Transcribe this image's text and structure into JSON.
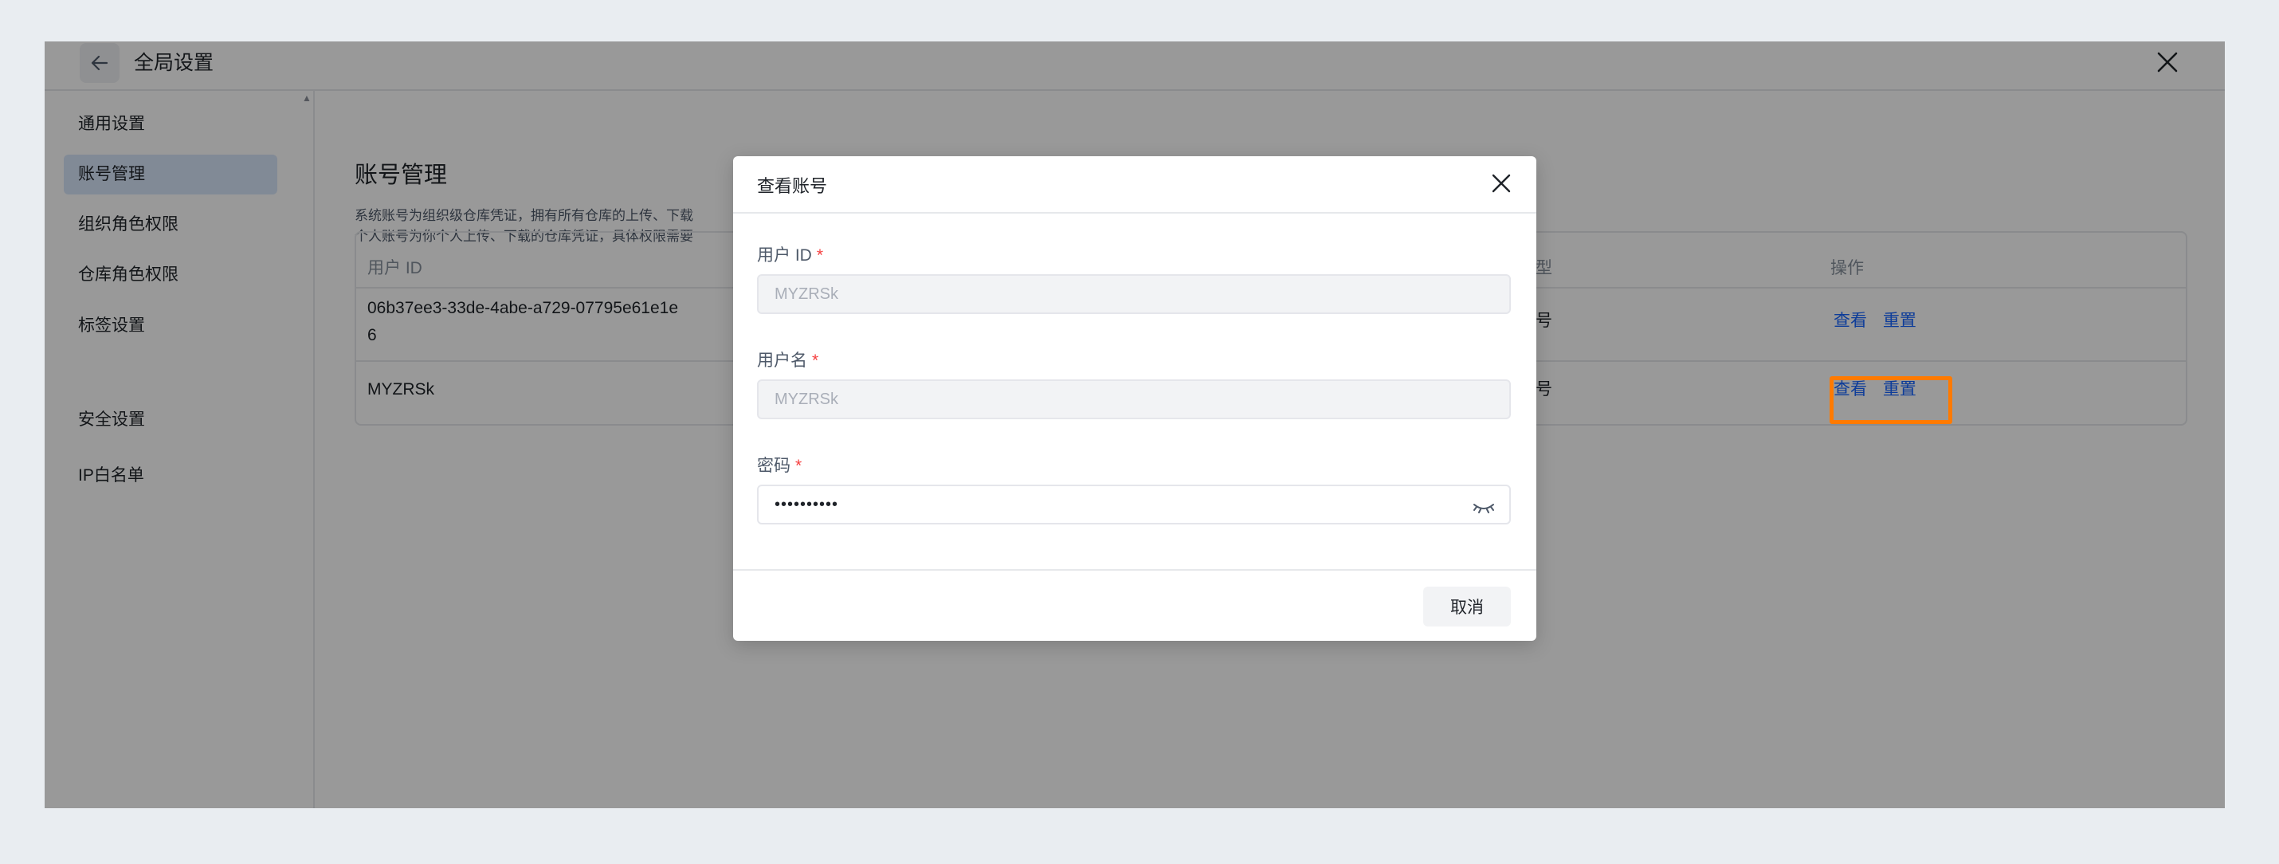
{
  "header": {
    "title": "全局设置"
  },
  "sidebar": {
    "items": [
      {
        "label": "通用设置",
        "active": false
      },
      {
        "label": "账号管理",
        "active": true
      },
      {
        "label": "组织角色权限",
        "active": false
      },
      {
        "label": "仓库角色权限",
        "active": false
      },
      {
        "label": "标签设置",
        "active": false
      },
      {
        "label": "安全设置",
        "active": false
      },
      {
        "label": "IP白名单",
        "active": false
      }
    ]
  },
  "main": {
    "title": "账号管理",
    "desc_line1": "系统账号为组织级仓库凭证，拥有所有仓库的上传、下载",
    "desc_line2": "个人账号为你个人上传、下载的仓库凭证，具体权限需要",
    "table": {
      "headers": {
        "user_id": "用户 ID",
        "type": "型",
        "actions": "操作"
      },
      "rows": [
        {
          "user_id_line1": "06b37ee3-33de-4abe-a729-07795e61e1e",
          "user_id_line2": "6",
          "type": "号",
          "view": "查看",
          "reset": "重置"
        },
        {
          "user_id_line1": "MYZRSk",
          "user_id_line2": "",
          "type": "号",
          "view": "查看",
          "reset": "重置"
        }
      ]
    }
  },
  "modal": {
    "title": "查看账号",
    "fields": {
      "user_id": {
        "label": "用户 ID",
        "required_mark": "*",
        "value": "MYZRSk"
      },
      "username": {
        "label": "用户名",
        "required_mark": "*",
        "value": "MYZRSk"
      },
      "password": {
        "label": "密码",
        "required_mark": "*",
        "value": "••••••••••"
      }
    },
    "cancel_label": "取消"
  },
  "icons": {
    "back": "arrow-left-icon",
    "close": "close-icon",
    "eye": "eye-closed-icon"
  },
  "colors": {
    "accent": "#1664ff",
    "highlight": "#ff7a00",
    "required": "#f53f3f",
    "active_nav_bg": "#d8e6fb"
  }
}
